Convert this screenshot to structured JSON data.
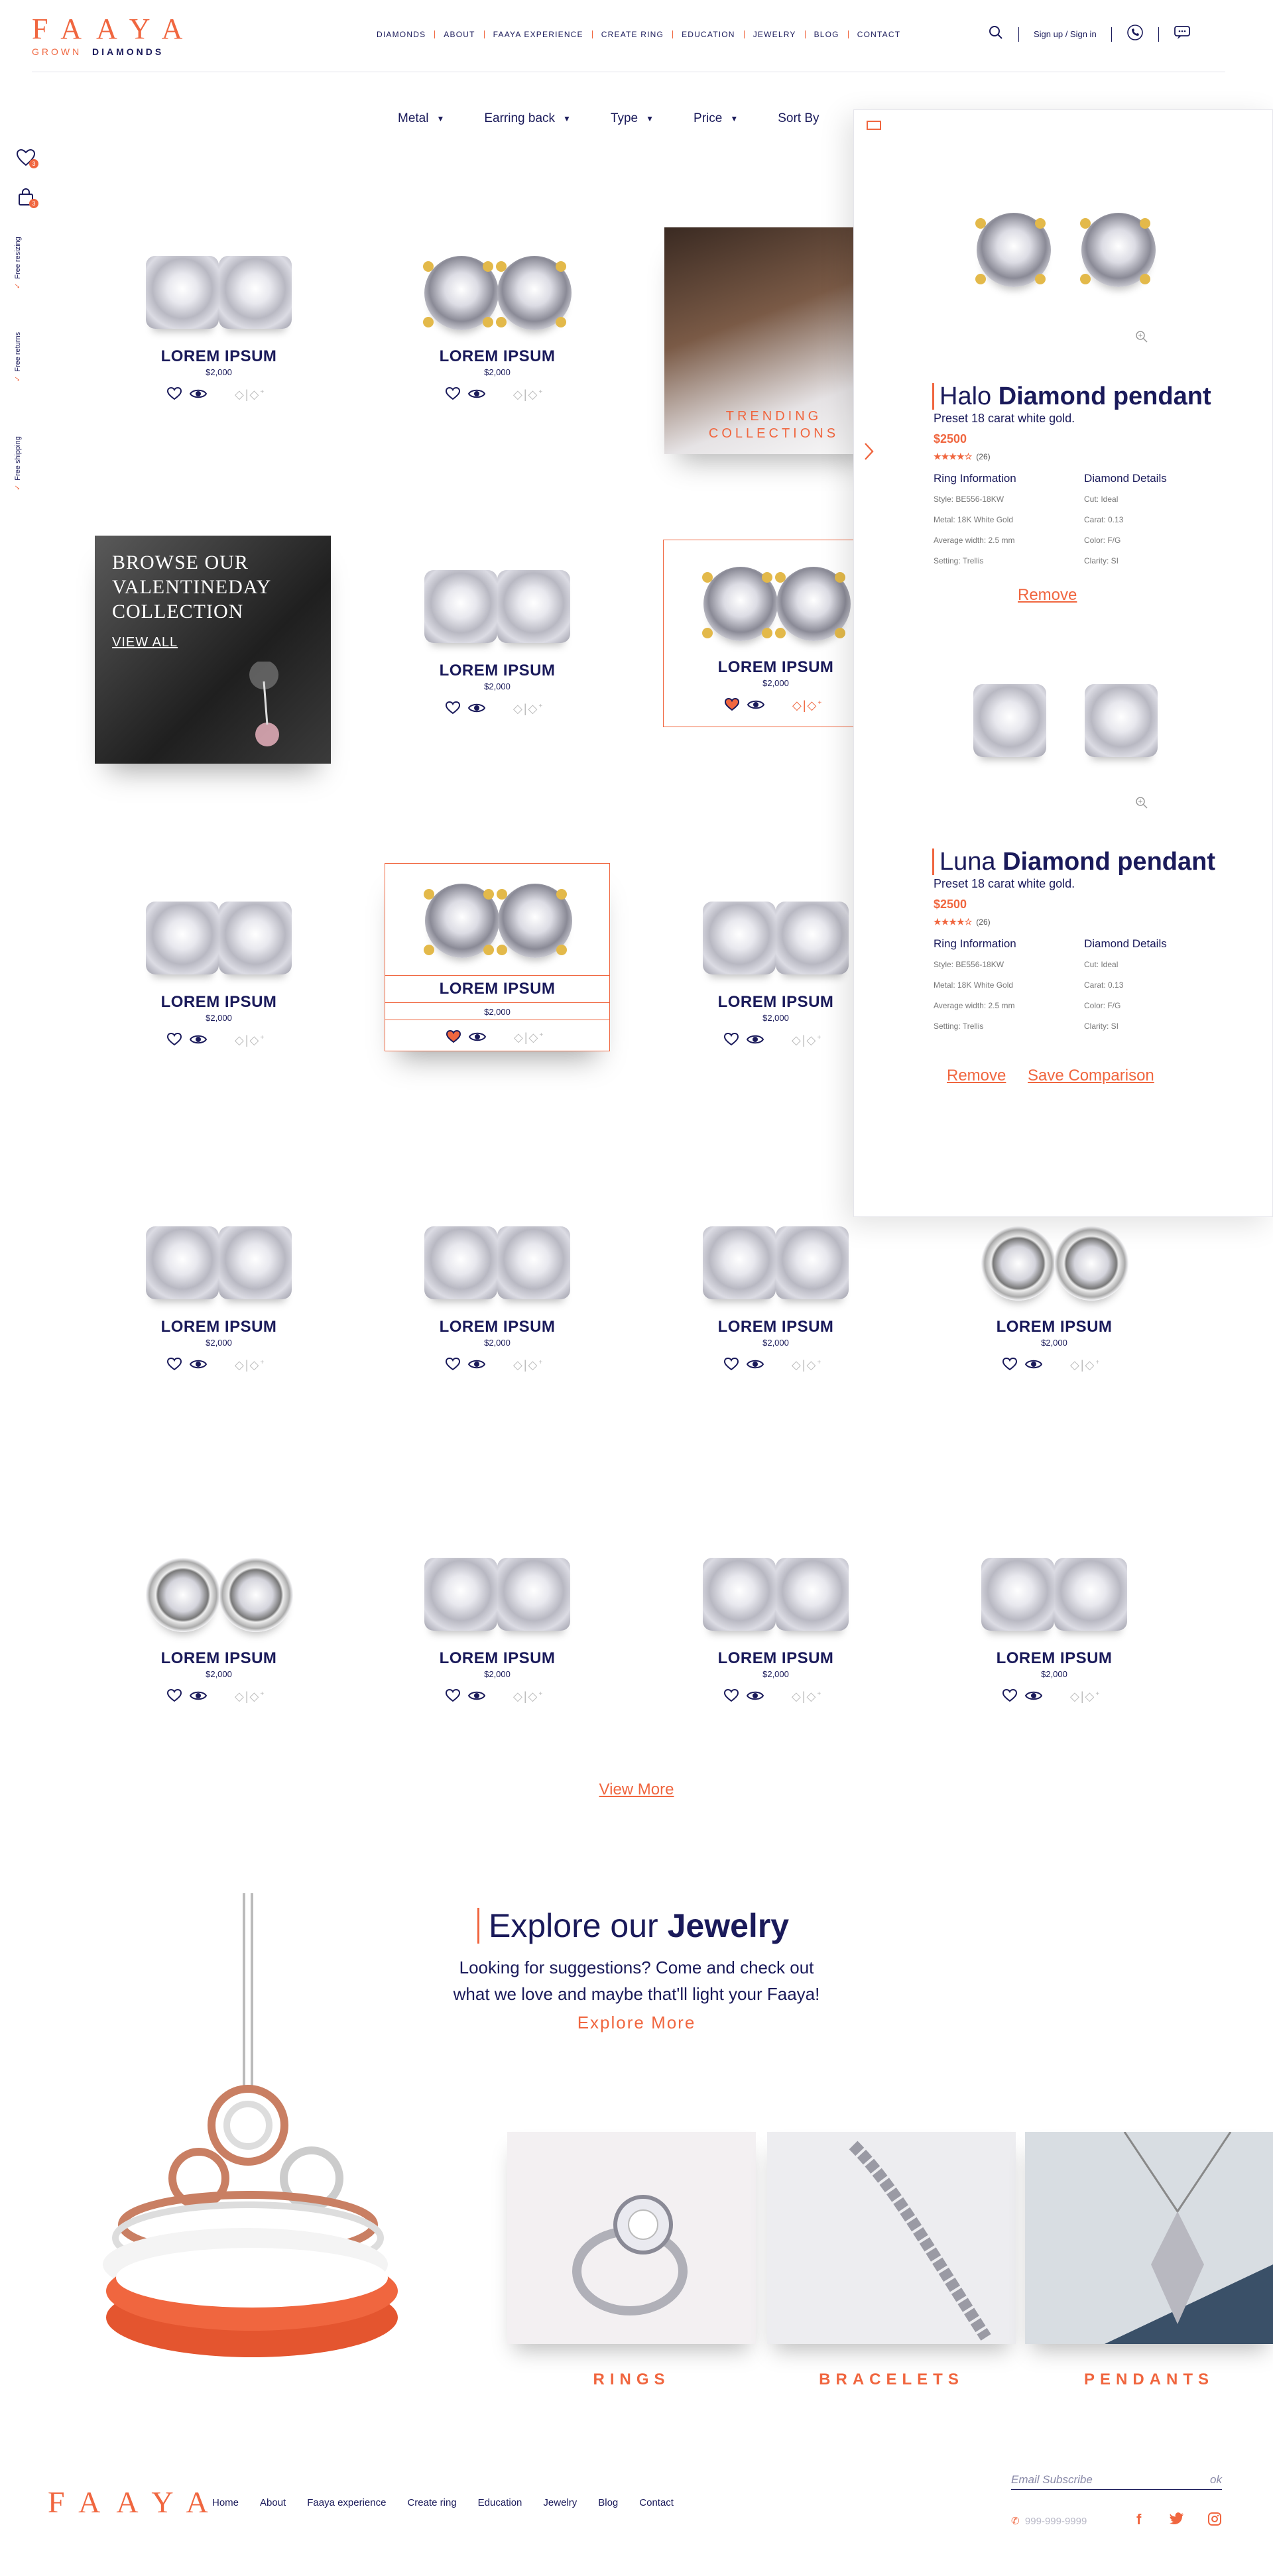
{
  "brand": {
    "logo": "FAAYA",
    "sub_grown": "GROWN",
    "sub_diamonds": "DIAMONDS"
  },
  "nav": [
    "DIAMONDS",
    "ABOUT",
    "FAAYA EXPERIENCE",
    "CREATE RING",
    "EDUCATION",
    "JEWELRY",
    "BLOG",
    "CONTACT"
  ],
  "header": {
    "signin": "Sign up / Sign in"
  },
  "side": {
    "wishlist_count": "3",
    "cart_count": "3",
    "features": [
      "Free resizing",
      "Free returns",
      "Free shipping"
    ]
  },
  "filters": [
    "Metal",
    "Earring back",
    "Type",
    "Price",
    "Sort By"
  ],
  "product": {
    "title": "LOREM IPSUM",
    "price": "$2,000"
  },
  "promo": {
    "valentine_text": [
      "BROWSE OUR",
      "VALENTINEDAY",
      "COLLECTION"
    ],
    "valentine_link": "VIEW ALL",
    "trending": [
      "TRENDING",
      "COLLECTIONS"
    ]
  },
  "compare": {
    "items": [
      {
        "title_light": "Halo",
        "title_bold": "Diamond pendant",
        "subtitle": "Preset 18 carat white gold.",
        "price": "$2500",
        "stars": "★★★★☆",
        "reviews": "(26)",
        "ring_info_label": "Ring Information",
        "diamond_label": "Diamond Details",
        "ring_info": [
          "Style: BE556-18KW",
          "Metal: 18K White Gold",
          "Average width: 2.5 mm",
          "Setting: Trellis"
        ],
        "diamond": [
          "Cut: Ideal",
          "Carat: 0.13",
          "Color: F/G",
          "Clarity: SI"
        ],
        "remove": "Remove"
      },
      {
        "title_light": "Luna",
        "title_bold": "Diamond pendant",
        "subtitle": "Preset 18 carat white gold.",
        "price": "$2500",
        "stars": "★★★★☆",
        "reviews": "(26)",
        "ring_info_label": "Ring Information",
        "diamond_label": "Diamond Details",
        "ring_info": [
          "Style: BE556-18KW",
          "Metal: 18K White Gold",
          "Average width: 2.5 mm",
          "Setting: Trellis"
        ],
        "diamond": [
          "Cut: Ideal",
          "Carat: 0.13",
          "Color: F/G",
          "Clarity: SI"
        ],
        "remove": "Remove",
        "save": "Save Comparison"
      }
    ]
  },
  "view_more": "View More",
  "explore": {
    "title_light": "Explore our",
    "title_bold": "Jewelry",
    "line1": "Looking for suggestions? Come and check out",
    "line2": "what we love and maybe that'll light your Faaya!",
    "link": "Explore More",
    "categories": [
      "RINGS",
      "BRACELETS",
      "PENDANTS"
    ]
  },
  "footer": {
    "logo": "FAAYA",
    "links": [
      "Home",
      "About",
      "Faaya experience",
      "Create ring",
      "Education",
      "Jewelry",
      "Blog",
      "Contact"
    ],
    "email_placeholder": "Email Subscribe",
    "ok": "ok",
    "phone": "999-999-9999"
  },
  "colors": {
    "accent": "#f0663f",
    "navy": "#1a1a5a"
  }
}
